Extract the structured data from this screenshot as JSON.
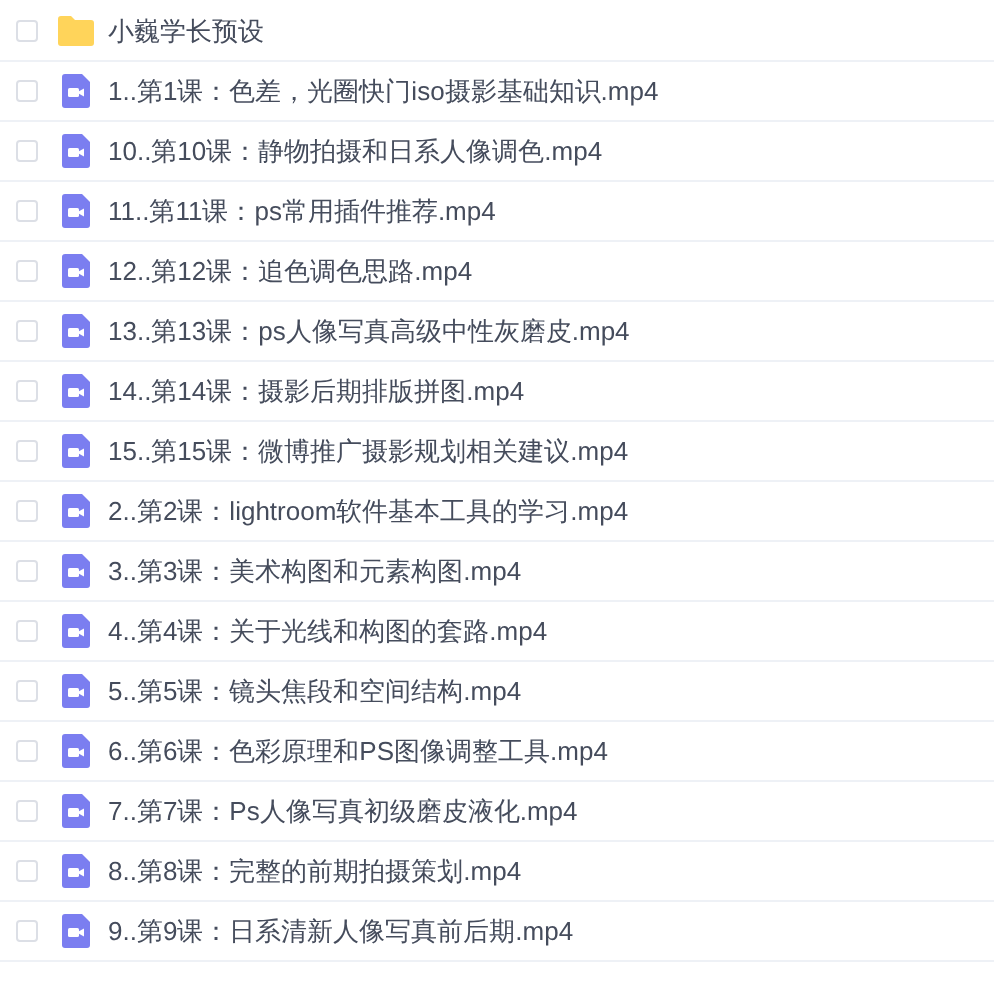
{
  "files": [
    {
      "kind": "folder",
      "name": "小巍学长预设",
      "checked": false
    },
    {
      "kind": "video",
      "name": "1..第1课：色差，光圈快门iso摄影基础知识.mp4",
      "checked": false
    },
    {
      "kind": "video",
      "name": "10..第10课：静物拍摄和日系人像调色.mp4",
      "checked": false
    },
    {
      "kind": "video",
      "name": "11..第11课：ps常用插件推荐.mp4",
      "checked": false
    },
    {
      "kind": "video",
      "name": "12..第12课：追色调色思路.mp4",
      "checked": false
    },
    {
      "kind": "video",
      "name": "13..第13课：ps人像写真高级中性灰磨皮.mp4",
      "checked": false
    },
    {
      "kind": "video",
      "name": "14..第14课：摄影后期排版拼图.mp4",
      "checked": false
    },
    {
      "kind": "video",
      "name": "15..第15课：微博推广摄影规划相关建议.mp4",
      "checked": false
    },
    {
      "kind": "video",
      "name": "2..第2课：lightroom软件基本工具的学习.mp4",
      "checked": false
    },
    {
      "kind": "video",
      "name": "3..第3课：美术构图和元素构图.mp4",
      "checked": false
    },
    {
      "kind": "video",
      "name": "4..第4课：关于光线和构图的套路.mp4",
      "checked": false
    },
    {
      "kind": "video",
      "name": "5..第5课：镜头焦段和空间结构.mp4",
      "checked": false
    },
    {
      "kind": "video",
      "name": "6..第6课：色彩原理和PS图像调整工具.mp4",
      "checked": false
    },
    {
      "kind": "video",
      "name": "7..第7课：Ps人像写真初级磨皮液化.mp4",
      "checked": false
    },
    {
      "kind": "video",
      "name": "8..第8课：完整的前期拍摄策划.mp4",
      "checked": false
    },
    {
      "kind": "video",
      "name": "9..第9课：日系清新人像写真前后期.mp4",
      "checked": false
    }
  ]
}
